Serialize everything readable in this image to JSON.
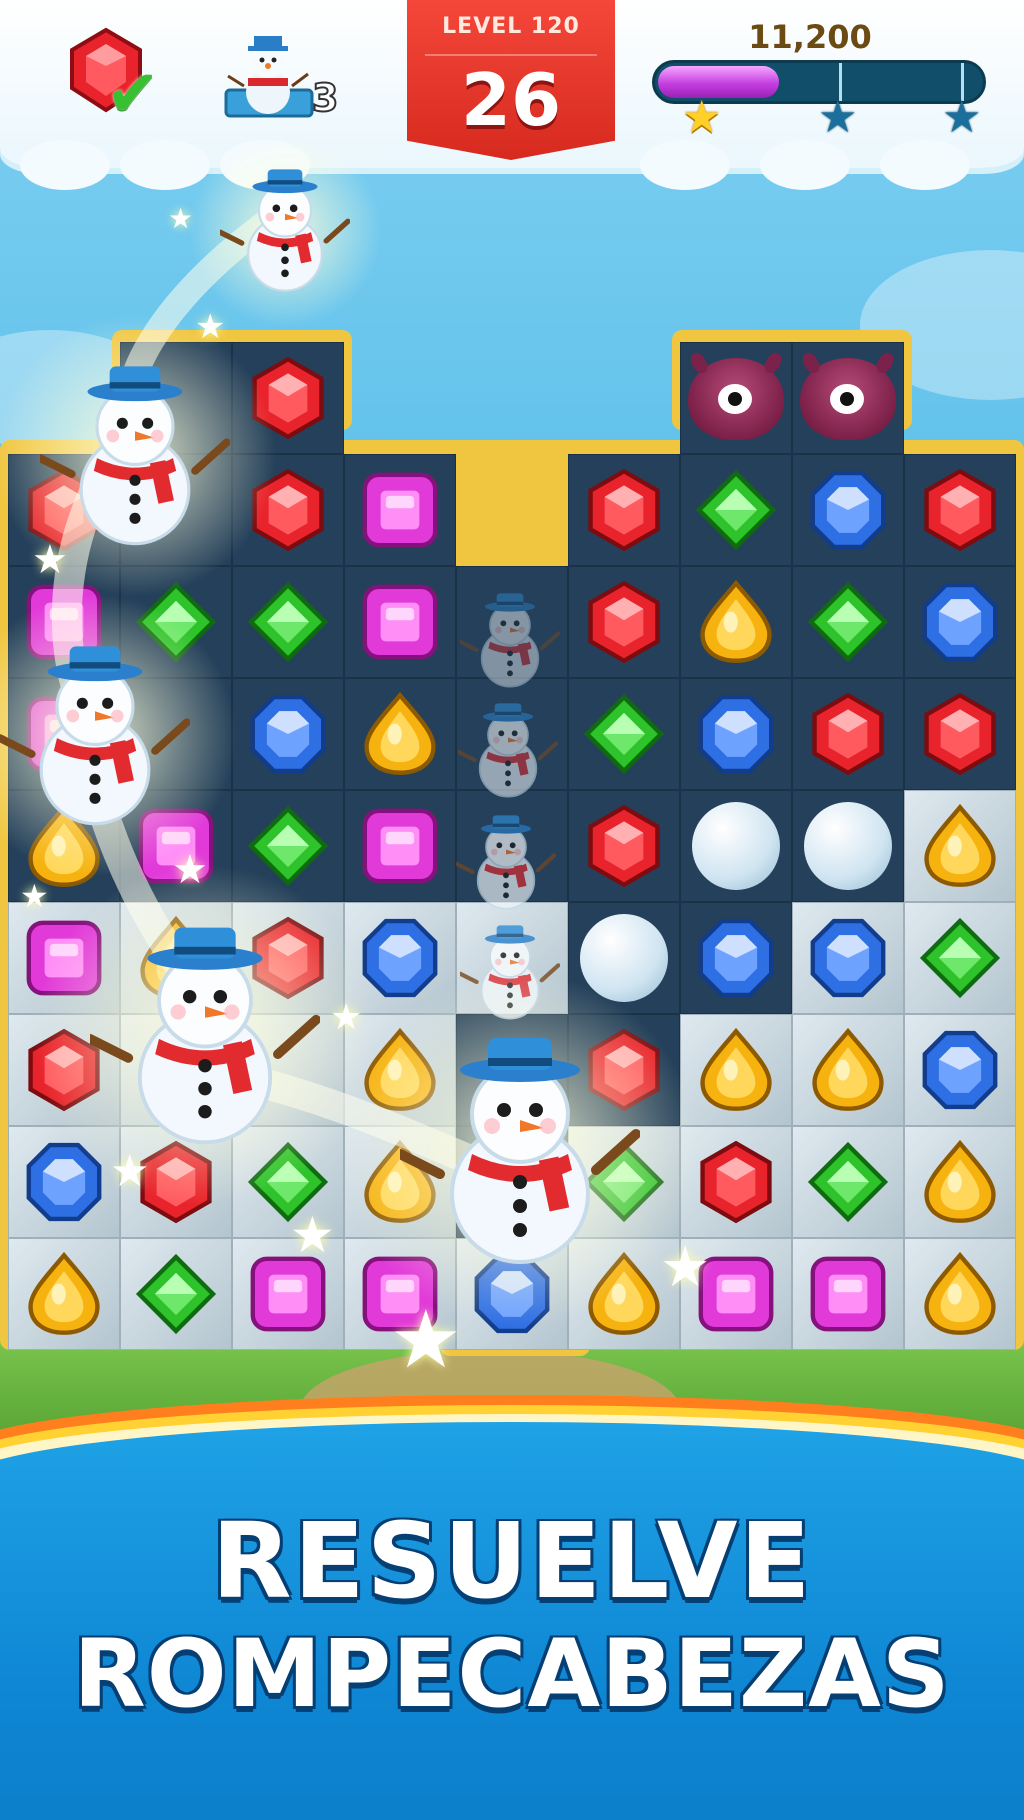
{
  "hud": {
    "goals": [
      {
        "name": "red-gem",
        "status": "completed",
        "icon": "check-icon"
      },
      {
        "name": "snowman",
        "count": "3"
      }
    ],
    "level_label": "LEVEL 120",
    "moves": "26",
    "score": "11,200",
    "progress": 0.37,
    "stars": [
      {
        "earned": true,
        "color": "#ffd02a"
      },
      {
        "earned": false,
        "color": "#1a6f9c"
      },
      {
        "earned": false,
        "color": "#1a6f9c"
      }
    ]
  },
  "board": {
    "grid": [
      [
        "",
        "",
        "red",
        "",
        "",
        "",
        "monster",
        "monster",
        ""
      ],
      [
        "red",
        "",
        "red",
        "purple",
        "",
        "red",
        "green",
        "blue",
        "red"
      ],
      [
        "purple",
        "green",
        "green",
        "purple",
        "",
        "red",
        "yellow",
        "green",
        "blue"
      ],
      [
        "purple",
        "",
        "blue",
        "yellow",
        "",
        "green",
        "blue",
        "red",
        "red"
      ],
      [
        "yellow",
        "purple",
        "green",
        "purple",
        "",
        "red",
        "snowball",
        "snowball",
        "yellow"
      ],
      [
        "purple",
        "yellow",
        "red",
        "blue",
        "",
        "snowball",
        "blue",
        "blue",
        "green"
      ],
      [
        "red",
        "",
        "",
        "yellow",
        "",
        "red",
        "yellow",
        "yellow",
        "blue"
      ],
      [
        "blue",
        "red",
        "green",
        "yellow",
        "",
        "green",
        "red",
        "green",
        "yellow"
      ],
      [
        "yellow",
        "green",
        "purple",
        "purple",
        "blue",
        "yellow",
        "purple",
        "purple",
        "yellow"
      ]
    ],
    "colors": {
      "red": "#e8232b",
      "green": "#2ec32a",
      "blue": "#2f6fe4",
      "purple": "#e13ad9",
      "yellow": "#f6b20f"
    }
  },
  "banner": {
    "line1": "RESUELVE",
    "line2": "ROMPECABEZAS"
  }
}
